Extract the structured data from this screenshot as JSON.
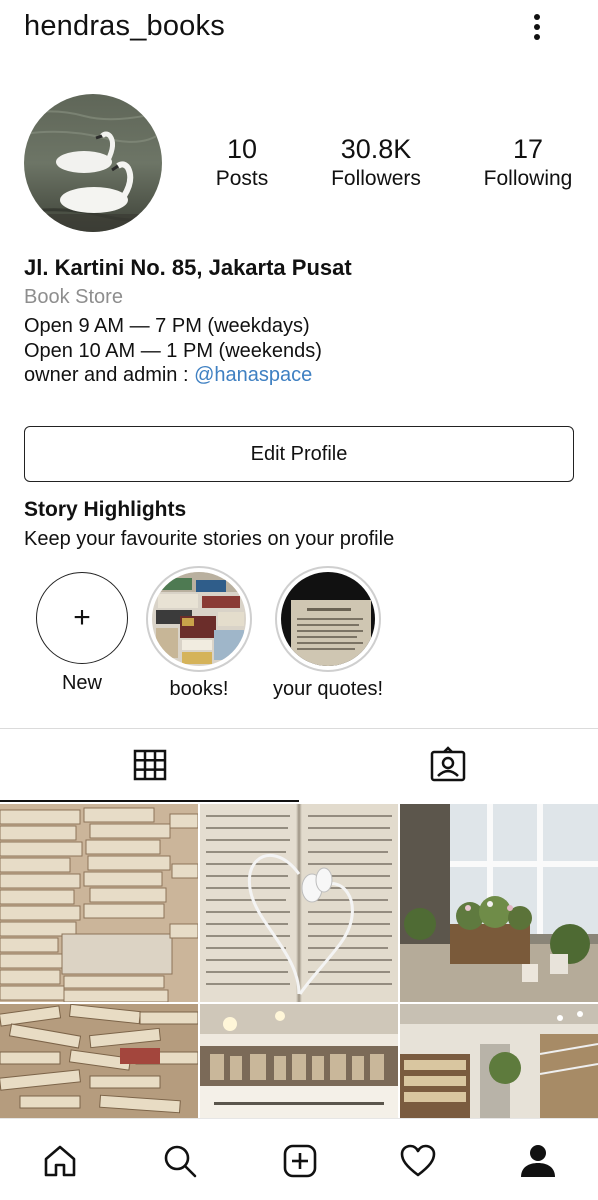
{
  "header": {
    "username": "hendras_books",
    "menu_icon": "more-vertical-icon"
  },
  "profile": {
    "stats": [
      {
        "value": "10",
        "label": "Posts"
      },
      {
        "value": "30.8K",
        "label": "Followers"
      },
      {
        "value": "17",
        "label": "Following"
      }
    ]
  },
  "bio": {
    "name": "Jl. Kartini No. 85, Jakarta Pusat",
    "category": "Book Store",
    "line1": "Open 9 AM — 7 PM (weekdays)",
    "line2": "Open 10 AM — 1 PM (weekends)",
    "line3_prefix": "owner and admin : ",
    "line3_mention": "@hanaspace"
  },
  "edit_profile_label": "Edit Profile",
  "highlights": {
    "title": "Story Highlights",
    "subtitle": "Keep your favourite stories on your profile",
    "new_symbol": "+",
    "items": [
      {
        "label": "New"
      },
      {
        "label": "books!"
      },
      {
        "label": "your quotes!"
      }
    ]
  },
  "tabs": {
    "active": "grid",
    "icons": [
      "grid-icon",
      "tagged-icon"
    ]
  },
  "bottom_nav": {
    "icons": [
      "home-icon",
      "search-icon",
      "add-post-icon",
      "heart-icon",
      "profile-icon"
    ],
    "active": "profile-icon"
  },
  "colors": {
    "mention": "#3f80c2",
    "secondary_text": "#8e8e8e",
    "border": "#dbdbdb"
  }
}
